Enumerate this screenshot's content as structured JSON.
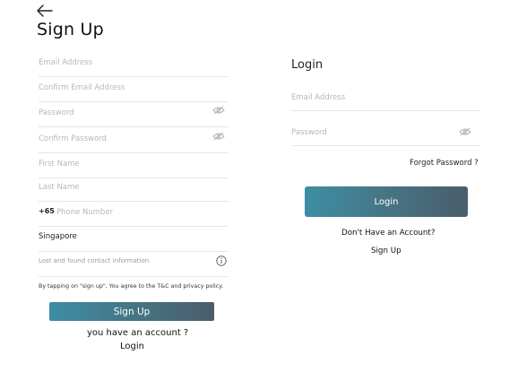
{
  "signup": {
    "title": "Sign Up",
    "email_placeholder": "Email Address",
    "confirm_email_placeholder": "Confirm Email Address",
    "password_placeholder": "Password",
    "confirm_password_placeholder": "Confirm Password",
    "first_name_placeholder": "First Name",
    "last_name_placeholder": "Last Name",
    "phone_prefix": "+65",
    "phone_placeholder": "Phone Number",
    "country": "Singapore",
    "lost_found_placeholder": "Lost and found contact information",
    "terms_text": "By tapping on \"sign up\", You agree to the T&C and privacy policy.",
    "signup_button": "Sign Up",
    "have_account_text": "you have an account ?",
    "login_link": "Login"
  },
  "login": {
    "title": "Login",
    "email_placeholder": "Email Address",
    "password_placeholder": "Password",
    "forgot_password": "Forgot Password ?",
    "login_button": "Login",
    "no_account_text": "Don't Have an Account?",
    "signup_link": "Sign Up"
  },
  "icons": {
    "back": "arrow-left-icon",
    "password_toggle": "eye-slash-icon",
    "info": "info-circle-icon"
  },
  "colors": {
    "button_gradient_start": "#3d8ea3",
    "button_gradient_end": "#4a5d6b",
    "divider": "#e6e6e6",
    "placeholder": "#b8b8b8"
  }
}
